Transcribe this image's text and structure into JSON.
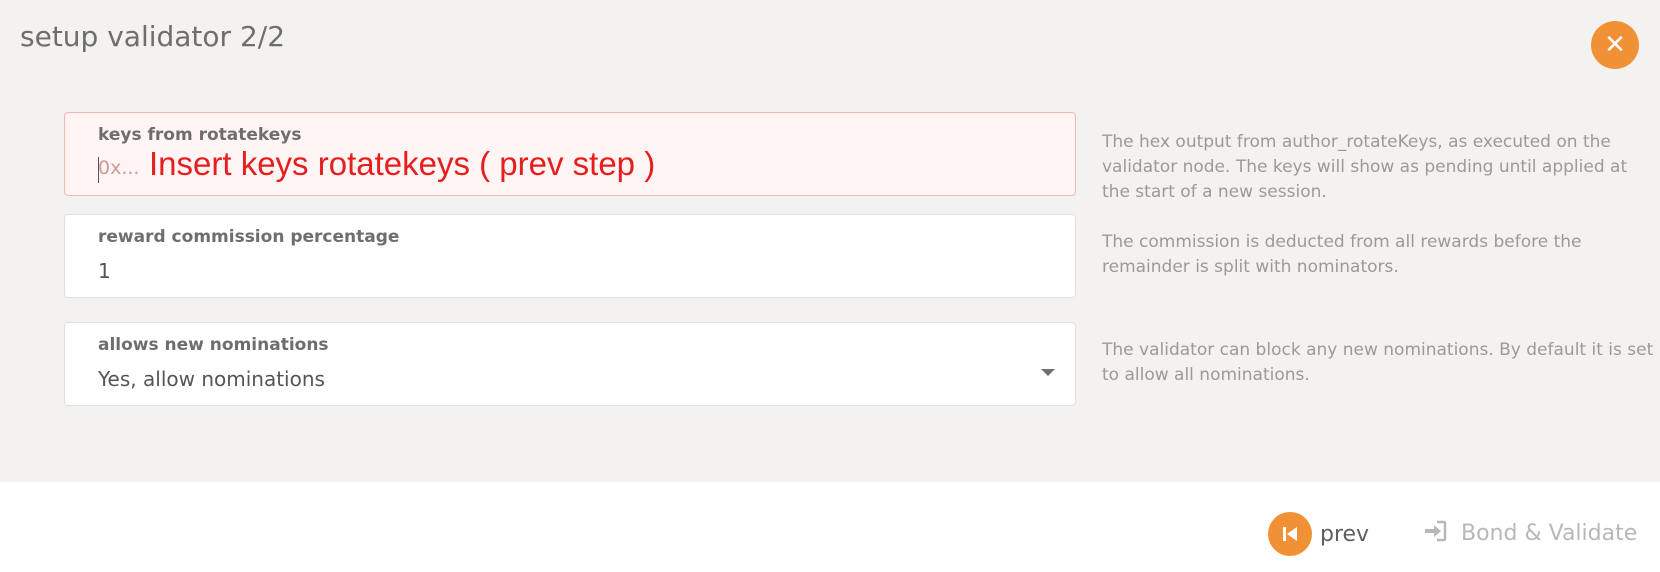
{
  "modal": {
    "title": "setup validator 2/2",
    "close_icon": "close-icon",
    "accent_color": "#f19135"
  },
  "fields": {
    "keys": {
      "label": "keys from rotatekeys",
      "placeholder": "0x...",
      "annotation": "Insert keys rotatekeys ( prev step )",
      "help": "The hex output from author_rotateKeys, as executed on the validator node. The keys will show as pending until applied at the start of a new session."
    },
    "commission": {
      "label": "reward commission percentage",
      "value": "1",
      "help": "The commission is deducted from all rewards before the remainder is split with nominators."
    },
    "nominations": {
      "label": "allows new nominations",
      "value": "Yes, allow nominations",
      "help": "The validator can block any new nominations. By default it is set to allow all nominations."
    }
  },
  "footer": {
    "prev_label": "prev",
    "prev_icon": "step-backward-icon",
    "bond_label": "Bond & Validate",
    "bond_icon": "sign-in-icon"
  }
}
